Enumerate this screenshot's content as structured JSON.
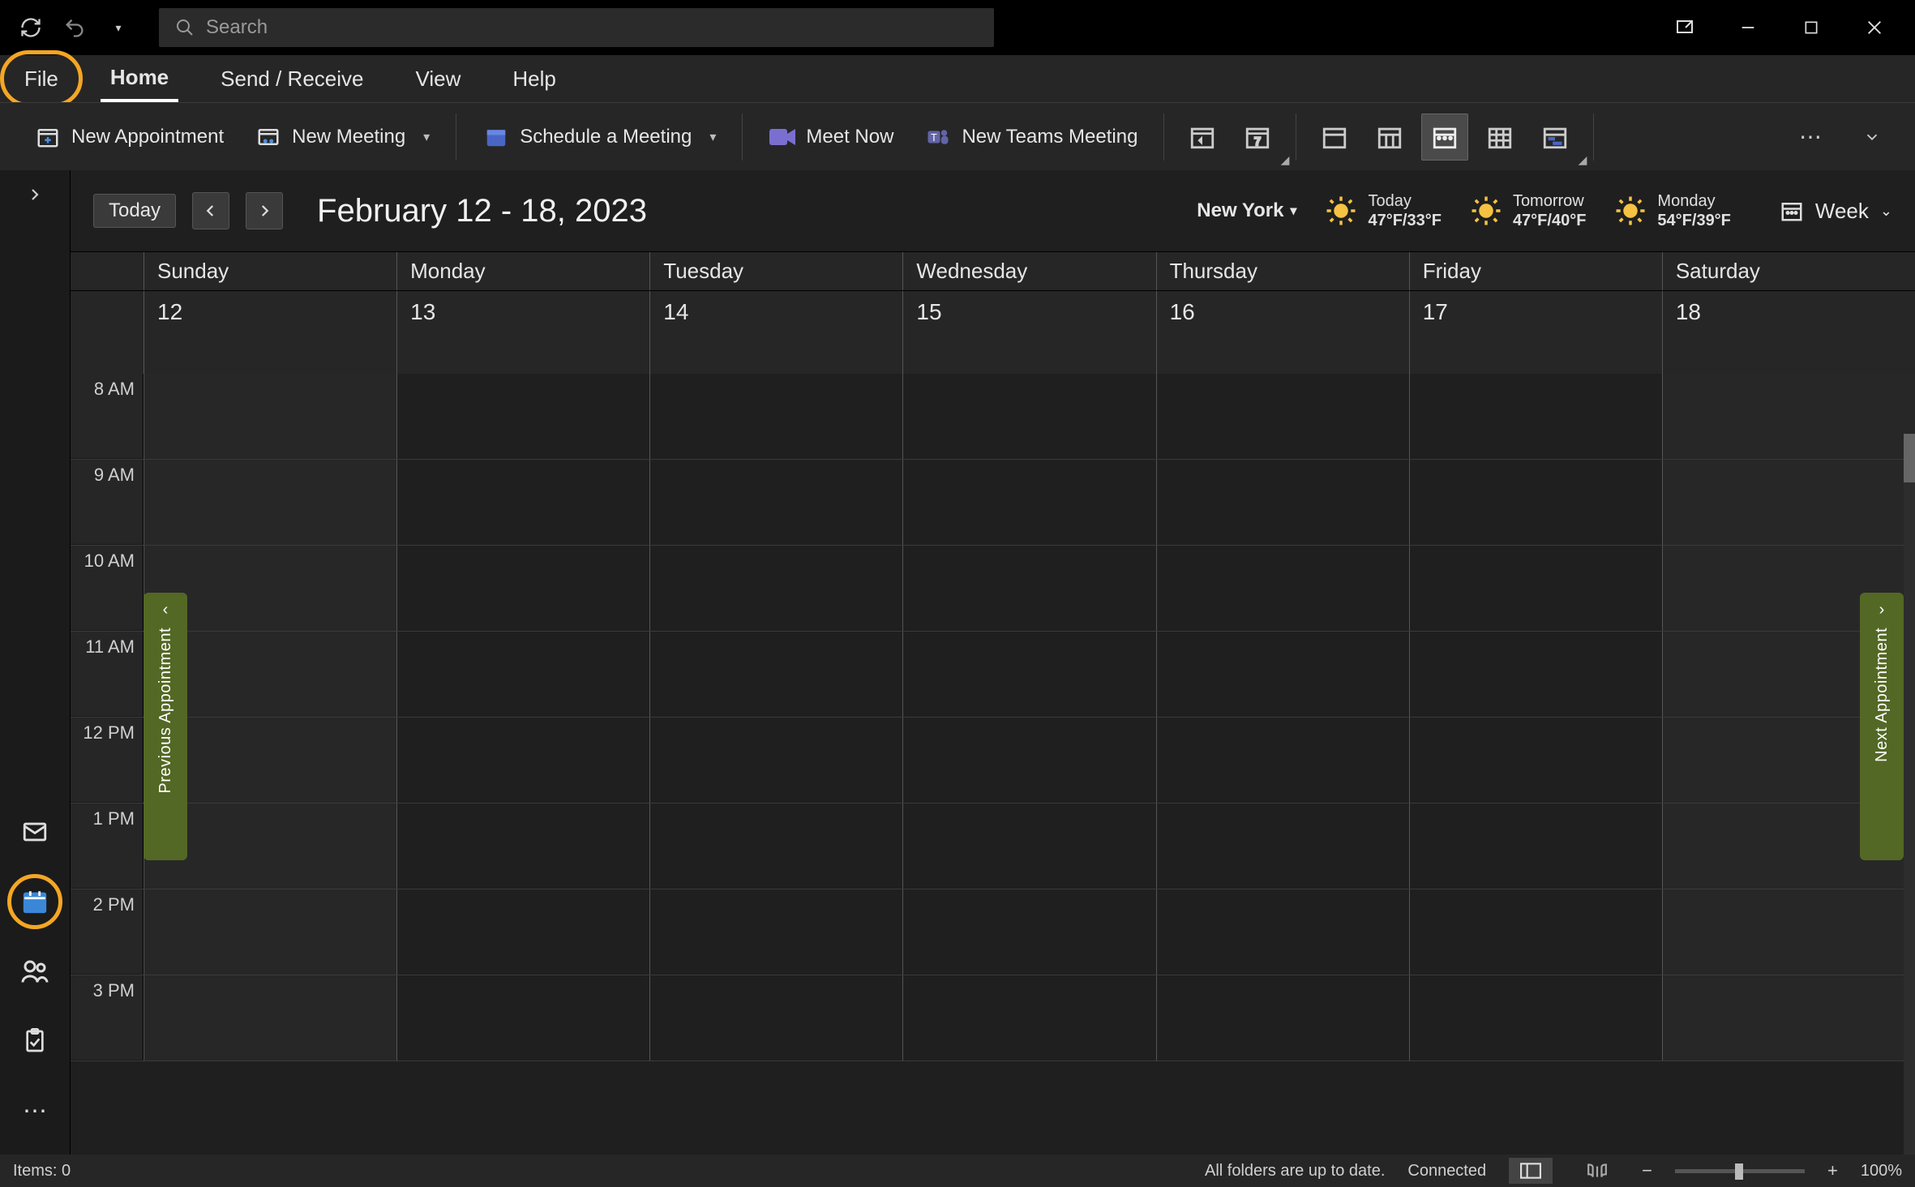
{
  "search": {
    "placeholder": "Search"
  },
  "tabs": {
    "file": "File",
    "home": "Home",
    "sendreceive": "Send / Receive",
    "view": "View",
    "help": "Help"
  },
  "ribbon": {
    "new_appointment": "New Appointment",
    "new_meeting": "New Meeting",
    "schedule_meeting": "Schedule a Meeting",
    "meet_now": "Meet Now",
    "new_teams_meeting": "New Teams Meeting"
  },
  "calheader": {
    "today_btn": "Today",
    "title": "February 12 - 18, 2023",
    "city": "New York",
    "view_label": "Week",
    "weather": [
      {
        "label": "Today",
        "temp": "47°F/33°F"
      },
      {
        "label": "Tomorrow",
        "temp": "47°F/40°F"
      },
      {
        "label": "Monday",
        "temp": "54°F/39°F"
      }
    ]
  },
  "days": [
    {
      "name": "Sunday",
      "date": "12"
    },
    {
      "name": "Monday",
      "date": "13"
    },
    {
      "name": "Tuesday",
      "date": "14"
    },
    {
      "name": "Wednesday",
      "date": "15"
    },
    {
      "name": "Thursday",
      "date": "16"
    },
    {
      "name": "Friday",
      "date": "17"
    },
    {
      "name": "Saturday",
      "date": "18"
    }
  ],
  "times": [
    "8 AM",
    "9 AM",
    "10 AM",
    "11 AM",
    "12 PM",
    "1 PM",
    "2 PM",
    "3 PM"
  ],
  "prev_appt": "Previous Appointment",
  "next_appt": "Next Appointment",
  "status": {
    "items": "Items: 0",
    "folders": "All folders are up to date.",
    "connected": "Connected",
    "zoom": "100%"
  }
}
